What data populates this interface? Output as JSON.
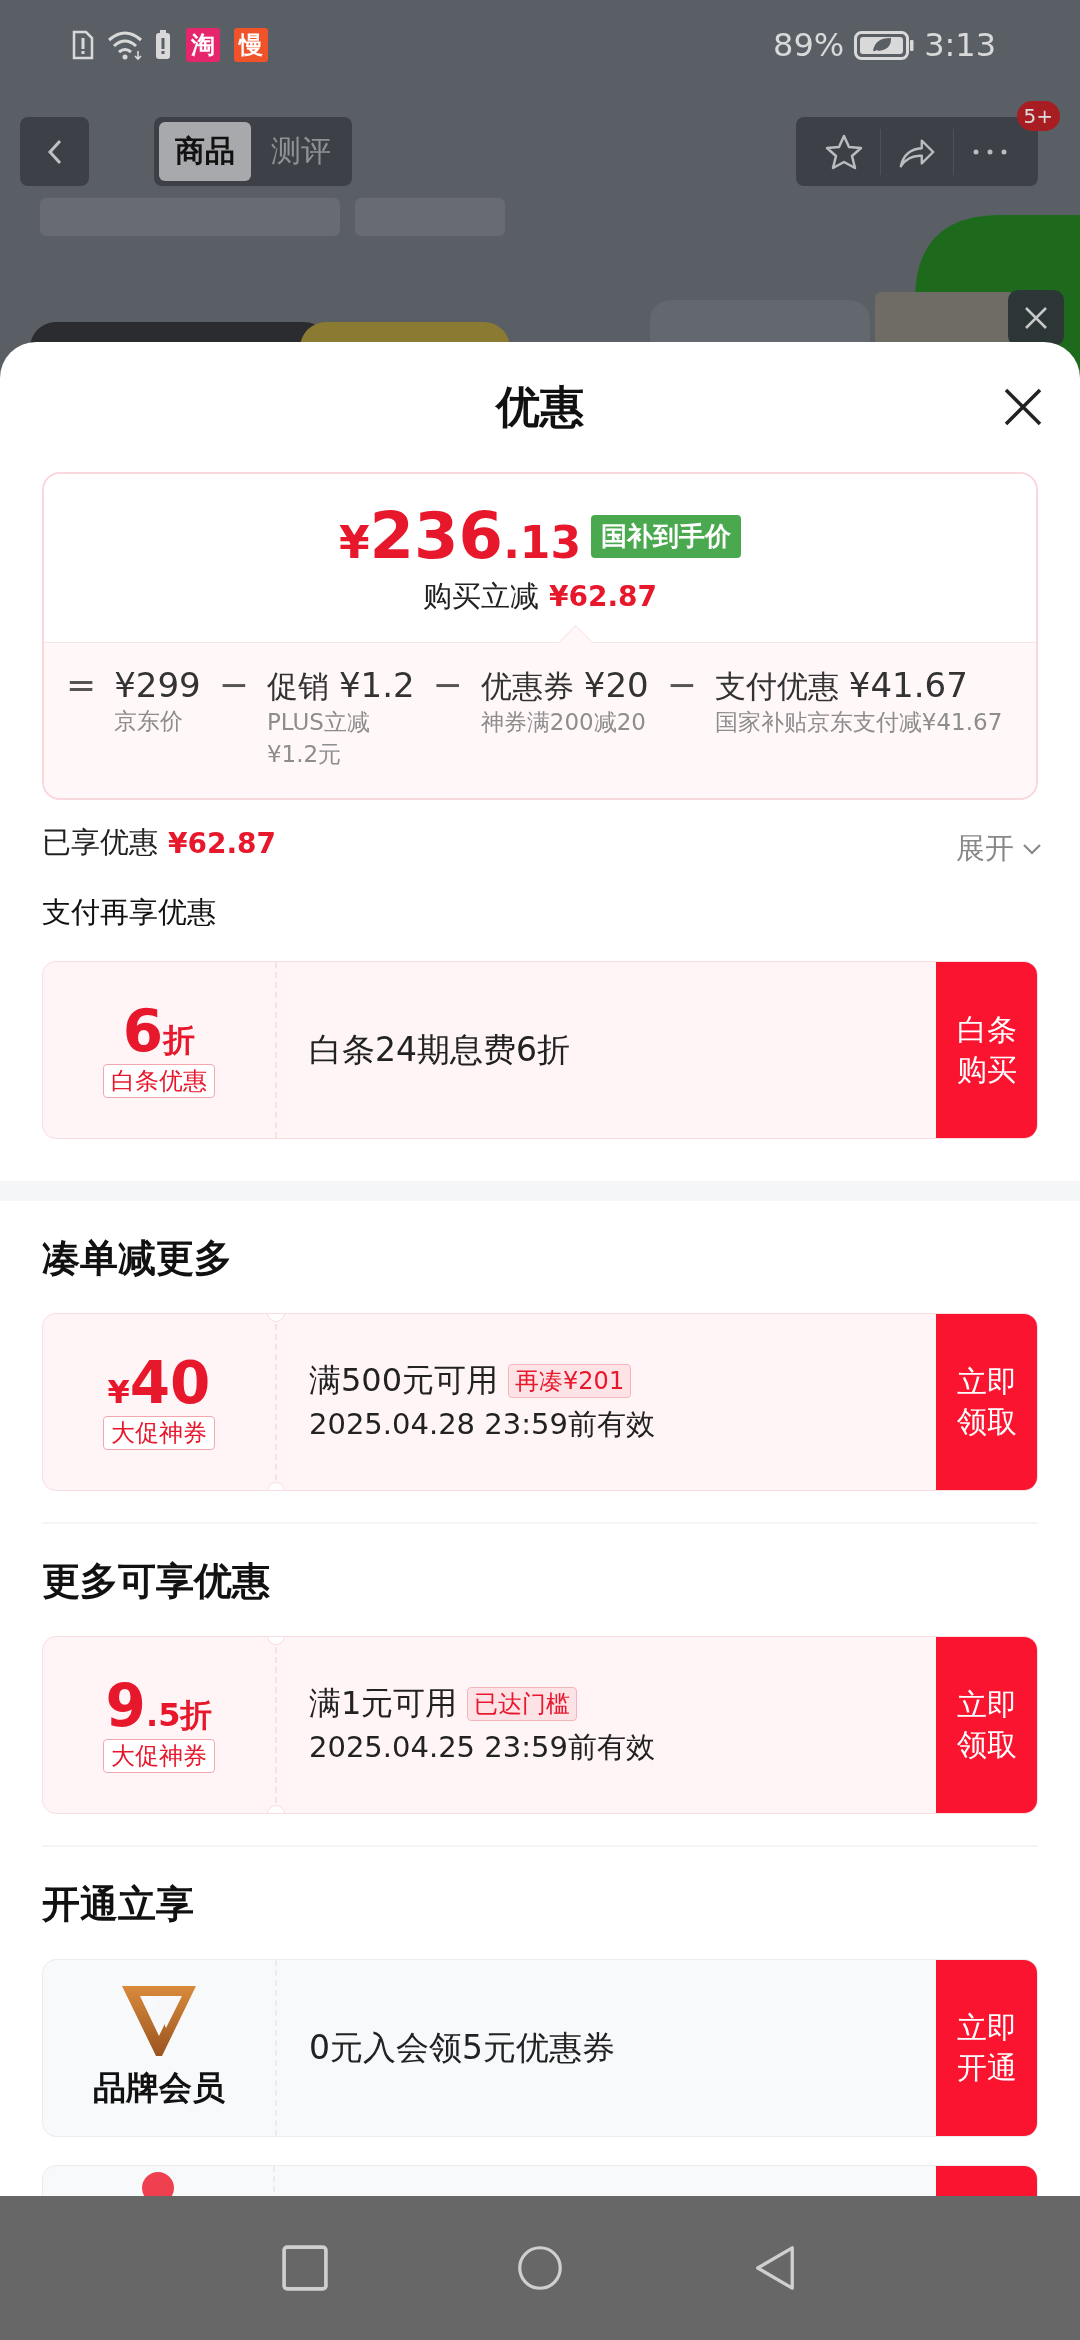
{
  "status_bar": {
    "notifications": [
      {
        "glyph": "淘",
        "color": "#e5266c"
      },
      {
        "glyph": "慢",
        "color": "#f0522a"
      }
    ],
    "battery_text": "89%",
    "time": "3:13"
  },
  "nav": {
    "tabs": [
      {
        "label": "商品",
        "selected": true
      },
      {
        "label": "测评",
        "selected": false
      }
    ],
    "badge": "5+"
  },
  "sheet": {
    "title": "优惠"
  },
  "price_card": {
    "currency": "¥",
    "integer": "236",
    "decimal": ".13",
    "badge": "国补到手价",
    "saving_label": "购买立减",
    "saving_amount": "¥62.87",
    "breakdown": [
      {
        "operator": "=",
        "amount": "¥299",
        "note": "京东价"
      },
      {
        "operator": "−",
        "title": "促销",
        "amount": "¥1.2",
        "note": "PLUS立减¥1.2元"
      },
      {
        "operator": "−",
        "title": "优惠券",
        "amount": "¥20",
        "note": "神券满200减20"
      },
      {
        "operator": "−",
        "title": "支付优惠",
        "amount": "¥41.67",
        "note": "国家补贴京东支付减¥41.67"
      }
    ]
  },
  "summary": {
    "label": "已享优惠",
    "amount": "¥62.87",
    "toggle": "展开",
    "expanded": false
  },
  "sections": [
    {
      "title": "支付再享优惠",
      "kind": "inline",
      "coupons": [
        {
          "kind": "discount",
          "value": "6",
          "suffix": "折",
          "tag": "白条优惠",
          "title": "白条24期息费6折",
          "button": "白条购买"
        }
      ]
    },
    {
      "title": "凑单减更多",
      "kind": "heading",
      "coupons": [
        {
          "kind": "cash",
          "prefix": "¥",
          "value": "40",
          "tag": "大促神券",
          "title": "满500元可用",
          "badge": "再凑¥201",
          "validity": "2025.04.28 23:59前有效",
          "button": "立即领取"
        }
      ]
    },
    {
      "title": "更多可享优惠",
      "kind": "heading",
      "coupons": [
        {
          "kind": "discount",
          "value": "9",
          "suffix": ".5折",
          "tag": "大促神券",
          "title": "满1元可用",
          "badge": "已达门槛",
          "validity": "2025.04.25 23:59前有效",
          "button": "立即领取"
        }
      ]
    },
    {
      "title": "开通立享",
      "kind": "heading",
      "coupons": [
        {
          "kind": "member",
          "tag": "品牌会员",
          "title": "0元入会领5元优惠券",
          "button": "立即开通"
        },
        {
          "kind": "cut"
        }
      ]
    }
  ]
}
